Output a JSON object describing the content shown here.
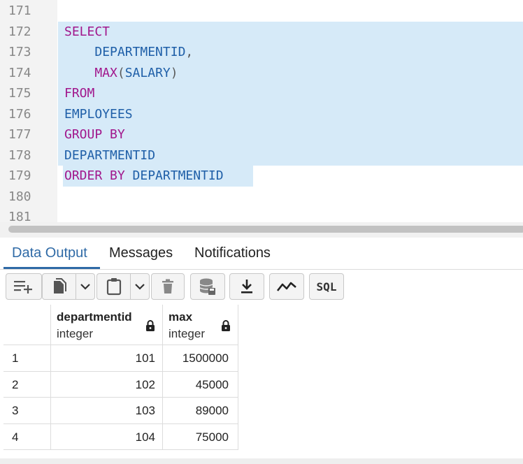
{
  "editor": {
    "lines": [
      {
        "num": "171",
        "tokens": []
      },
      {
        "num": "172",
        "tokens": [
          {
            "t": "SELECT",
            "c": "kw"
          }
        ]
      },
      {
        "num": "173",
        "tokens": [
          {
            "t": "    ",
            "c": "pn"
          },
          {
            "t": "DEPARTMENTID",
            "c": "id"
          },
          {
            "t": ",",
            "c": "pn"
          }
        ]
      },
      {
        "num": "174",
        "tokens": [
          {
            "t": "    ",
            "c": "pn"
          },
          {
            "t": "MAX",
            "c": "kw"
          },
          {
            "t": "(",
            "c": "pn"
          },
          {
            "t": "SALARY",
            "c": "id"
          },
          {
            "t": ")",
            "c": "pn"
          }
        ]
      },
      {
        "num": "175",
        "tokens": [
          {
            "t": "FROM",
            "c": "kw"
          }
        ]
      },
      {
        "num": "176",
        "tokens": [
          {
            "t": "EMPLOYEES",
            "c": "id"
          }
        ]
      },
      {
        "num": "177",
        "tokens": [
          {
            "t": "GROUP BY",
            "c": "kw"
          }
        ]
      },
      {
        "num": "178",
        "tokens": [
          {
            "t": "DEPARTMENTID",
            "c": "id"
          }
        ]
      },
      {
        "num": "179",
        "tokens": [
          {
            "t": "ORDER BY",
            "c": "kw"
          },
          {
            "t": " ",
            "c": "pn"
          },
          {
            "t": "DEPARTMENTID",
            "c": "id"
          }
        ]
      },
      {
        "num": "180",
        "tokens": []
      },
      {
        "num": "181",
        "tokens": []
      }
    ]
  },
  "tabs": [
    {
      "label": "Data Output",
      "active": true
    },
    {
      "label": "Messages",
      "active": false
    },
    {
      "label": "Notifications",
      "active": false
    }
  ],
  "toolbar": {
    "sql_label": "SQL",
    "icons": [
      "add-row-icon",
      "copy-icon",
      "chevron-down-icon",
      "paste-icon",
      "chevron-down-icon",
      "delete-icon",
      "save-data-icon",
      "download-icon",
      "graph-icon",
      "sql-icon"
    ]
  },
  "grid": {
    "columns": [
      {
        "name": "departmentid",
        "type": "integer"
      },
      {
        "name": "max",
        "type": "integer"
      }
    ],
    "rows": [
      {
        "num": "1",
        "departmentid": "101",
        "max": "1500000"
      },
      {
        "num": "2",
        "departmentid": "102",
        "max": "45000"
      },
      {
        "num": "3",
        "departmentid": "103",
        "max": "89000"
      },
      {
        "num": "4",
        "departmentid": "104",
        "max": "75000"
      }
    ]
  },
  "colors": {
    "keyword": "#a1178c",
    "identifier": "#1f5fa8",
    "selection": "#d6eaf8",
    "active_tab": "#2f6aa6"
  }
}
